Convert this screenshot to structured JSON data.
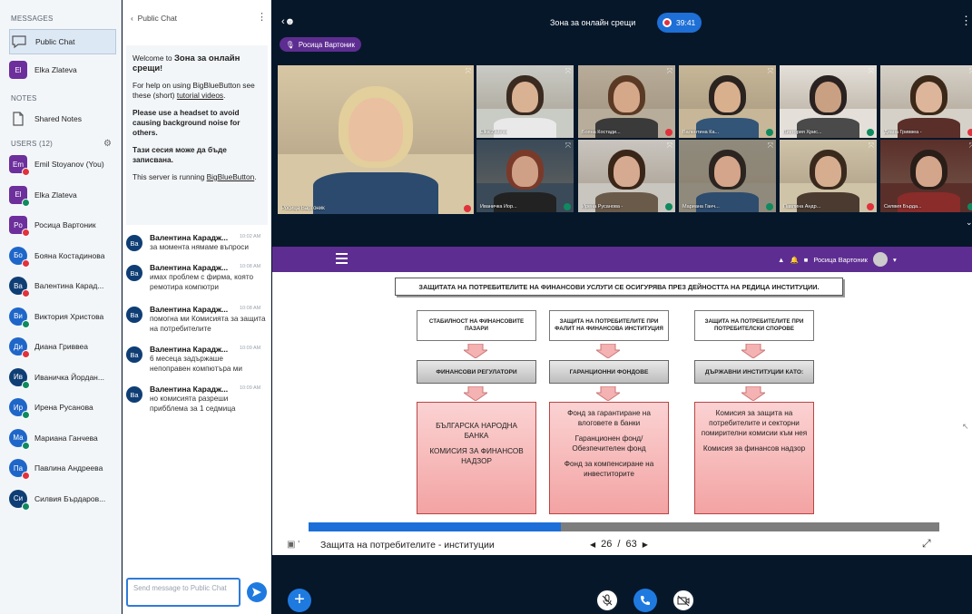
{
  "sidebar": {
    "messages_header": "MESSAGES",
    "public_chat": "Public Chat",
    "elka": {
      "initials": "El",
      "name": "Elka Zlateva"
    },
    "notes_header": "NOTES",
    "shared_notes": "Shared Notes",
    "users_header": "USERS (12)",
    "users": [
      {
        "initials": "Em",
        "name": "Emil Stoyanov (You)",
        "color": "#6d2f9c",
        "status": "mute",
        "shape": "square"
      },
      {
        "initials": "El",
        "name": "Elka Zlateva",
        "color": "#6d2f9c",
        "status": "on",
        "shape": "square"
      },
      {
        "initials": "Po",
        "name": "Росица Вартоник",
        "color": "#6d2f9c",
        "status": "mute",
        "shape": "square"
      },
      {
        "initials": "Бо",
        "name": "Бояна Костадинова",
        "color": "#1f66c9",
        "status": "mute",
        "shape": "round"
      },
      {
        "initials": "Ва",
        "name": "Валентина Карад...",
        "color": "#0f3e75",
        "status": "mute",
        "shape": "round"
      },
      {
        "initials": "Ви",
        "name": "Виктория Христова",
        "color": "#1f66c9",
        "status": "on",
        "shape": "round"
      },
      {
        "initials": "Ди",
        "name": "Диана Гриввеа",
        "color": "#1f66c9",
        "status": "mute",
        "shape": "round"
      },
      {
        "initials": "Ив",
        "name": "Иваничка Йордан...",
        "color": "#0f3e75",
        "status": "on",
        "shape": "round"
      },
      {
        "initials": "Ир",
        "name": "Ирена Русанова",
        "color": "#1f66c9",
        "status": "on",
        "shape": "round"
      },
      {
        "initials": "Ма",
        "name": "Мариана Ганчева",
        "color": "#1f66c9",
        "status": "on",
        "shape": "round"
      },
      {
        "initials": "Па",
        "name": "Павлина Андреева",
        "color": "#1f66c9",
        "status": "mute",
        "shape": "round"
      },
      {
        "initials": "Си",
        "name": "Силвия Бърдаров...",
        "color": "#0f3e75",
        "status": "on",
        "shape": "round"
      }
    ]
  },
  "chat": {
    "header": "Public Chat",
    "welcome_title_prefix": "Welcome to ",
    "welcome_title_bold": "Зона за онлайн срещи",
    "welcome_title_suffix": "!",
    "help_text": "For help on using BigBlueButton see these (short) ",
    "help_link": "tutorial videos",
    "help_end": ".",
    "headset": "Please use a headset to avoid causing background noise for others.",
    "recorded": "Тази сесия може да бъде записвана.",
    "server_prefix": "This server is running ",
    "server_link": "BigBlueButton",
    "server_end": ".",
    "messages": [
      {
        "initials": "Ва",
        "name": "Валентина Карадж...",
        "time": "10:02 AM",
        "text": "за момента нямаме въпроси"
      },
      {
        "initials": "Ва",
        "name": "Валентина Карадж...",
        "time": "10:08 AM",
        "text": "имах проблем с фирма, която ремотира компютри"
      },
      {
        "initials": "Ва",
        "name": "Валентина Карадж...",
        "time": "10:08 AM",
        "text": "помогна ми Комисията за защита на потребителите"
      },
      {
        "initials": "Ва",
        "name": "Валентина Карадж...",
        "time": "10:09 AM",
        "text": "6 месеца задържаше непоправен компютъра ми"
      },
      {
        "initials": "Ва",
        "name": "Валентина Карадж...",
        "time": "10:09 AM",
        "text": "но комисията разреши прибблема за 1 седмица"
      }
    ],
    "input_placeholder": "Send message to Public Chat"
  },
  "main": {
    "title": "Зона за онлайн срещи",
    "timer": "39:41",
    "presenter": "Росица Вартоник",
    "tiles": [
      {
        "name": "Росица Вартоник",
        "mic": "mute",
        "wall": "#d8c7a4",
        "skin": "#e9c0a0",
        "hair": "#e2cf9c",
        "shirt": "#2b4a6e"
      },
      {
        "name": "Elka Zlateva",
        "mic": "none",
        "wall": "#c9cbc5",
        "skin": "#d9b193",
        "hair": "#3a2a20",
        "shirt": "#e9e9e9"
      },
      {
        "name": "Бояна Костади...",
        "mic": "mute",
        "wall": "#b8ad9a",
        "skin": "#d5a88a",
        "hair": "#5b3a25",
        "shirt": "#3a3a3a"
      },
      {
        "name": "Валентина Ка...",
        "mic": "on",
        "wall": "#c7b798",
        "skin": "#d9b08e",
        "hair": "#2b2320",
        "shirt": "#335577"
      },
      {
        "name": "Виктория Хрис...",
        "mic": "on",
        "wall": "#e4e0d9",
        "skin": "#caa083",
        "hair": "#2a2220",
        "shirt": "#4a4a4a"
      },
      {
        "name": "Диана Гриввеа -",
        "mic": "mute",
        "wall": "#d6d1c8",
        "skin": "#dcb59a",
        "hair": "#3b2818",
        "shirt": "#5a2f2a"
      },
      {
        "name": "Иваничка Йор...",
        "mic": "on",
        "wall": "#3a4a58",
        "skin": "#cf9f86",
        "hair": "#7a3a2a",
        "shirt": "#222222"
      },
      {
        "name": "Ирена Русанова -",
        "mic": "on",
        "wall": "#c9c5bf",
        "skin": "#d6aa90",
        "hair": "#3a2618",
        "shirt": "#6a5a4a"
      },
      {
        "name": "Мариана Ганч...",
        "mic": "on",
        "wall": "#8f8a7c",
        "skin": "#d4a58a",
        "hair": "#2c2420",
        "shirt": "#2e4c6d"
      },
      {
        "name": "Павлина Андр...",
        "mic": "mute",
        "wall": "#cfc3a8",
        "skin": "#d7ad90",
        "hair": "#3a2a1e",
        "shirt": "#4a3a30"
      },
      {
        "name": "Силвия Бърда...",
        "mic": "on",
        "wall": "#5a2f2a",
        "skin": "#d3a58a",
        "hair": "#2a1e18",
        "shirt": "#8a2c2a"
      }
    ],
    "pres_user": "Росица Вартоник",
    "slide": {
      "title": "ЗАЩИТАТА НА ПОТРЕБИТЕЛИТЕ НА ФИНАНСОВИ УСЛУГИ СЕ ОСИГУРЯВА ПРЕЗ ДЕЙНОСТТА НА РЕДИЦА ИНСТИТУЦИИ.",
      "columns": [
        {
          "head": "СТАБИЛНОСТ НА ФИНАНСОВИТЕ ПАЗАРИ",
          "mid": "ФИНАНСОВИ РЕГУЛАТОРИ",
          "items": [
            "БЪЛГАРСКА НАРОДНА БАНКА",
            "КОМИСИЯ ЗА ФИНАНСОВ НАДЗОР"
          ]
        },
        {
          "head": "ЗАЩИТА НА ПОТРЕБИТЕЛИТЕ ПРИ ФАЛИТ НА ФИНАНСОВА ИНСТИТУЦИЯ",
          "mid": "ГАРАНЦИОННИ ФОНДОВЕ",
          "items": [
            "Фонд за гарантиране на влоговете в банки",
            "Гаранционен фонд/Обезпечителен фонд",
            "Фонд за компенсиране на инвеститорите"
          ]
        },
        {
          "head": "ЗАЩИТА НА ПОТРЕБИТЕЛИТЕ ПРИ ПОТРЕБИТЕЛСКИ СПОРОВЕ",
          "mid": "ДЪРЖАВНИ ИНСТИТУЦИИ КАТО:",
          "items": [
            "Комисия за защита на потребителите и секторни помирителни комисии към нея",
            "Комисия за финансов надзор"
          ]
        }
      ]
    },
    "slide_name": "Защита на потребителите - институции",
    "current_page": "26",
    "total_pages": "63",
    "page_sep": "/",
    "progress": 0.4
  },
  "colors": {
    "accent": "#5e2d91",
    "blue": "#1f7ae0",
    "mute": "#e0323c",
    "on": "#0f8a5f"
  }
}
